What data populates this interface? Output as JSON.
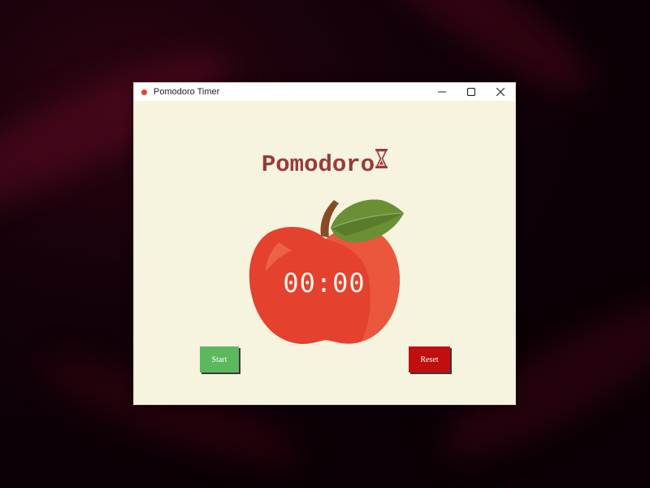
{
  "window": {
    "title": "Pomodoro Timer",
    "controls": {
      "minimize": "minimize-icon",
      "maximize": "maximize-icon",
      "close": "close-icon"
    }
  },
  "app": {
    "heading": "Pomodoro",
    "heading_icon": "hourglass-icon",
    "timer": "00:00",
    "start_label": "Start",
    "reset_label": "Reset"
  },
  "colors": {
    "background": "#f6f3df",
    "heading": "#9a3a3a",
    "apple": "#e4412f",
    "leaf": "#6a8f35",
    "start": "#5cb85c",
    "reset": "#c10e0e"
  }
}
